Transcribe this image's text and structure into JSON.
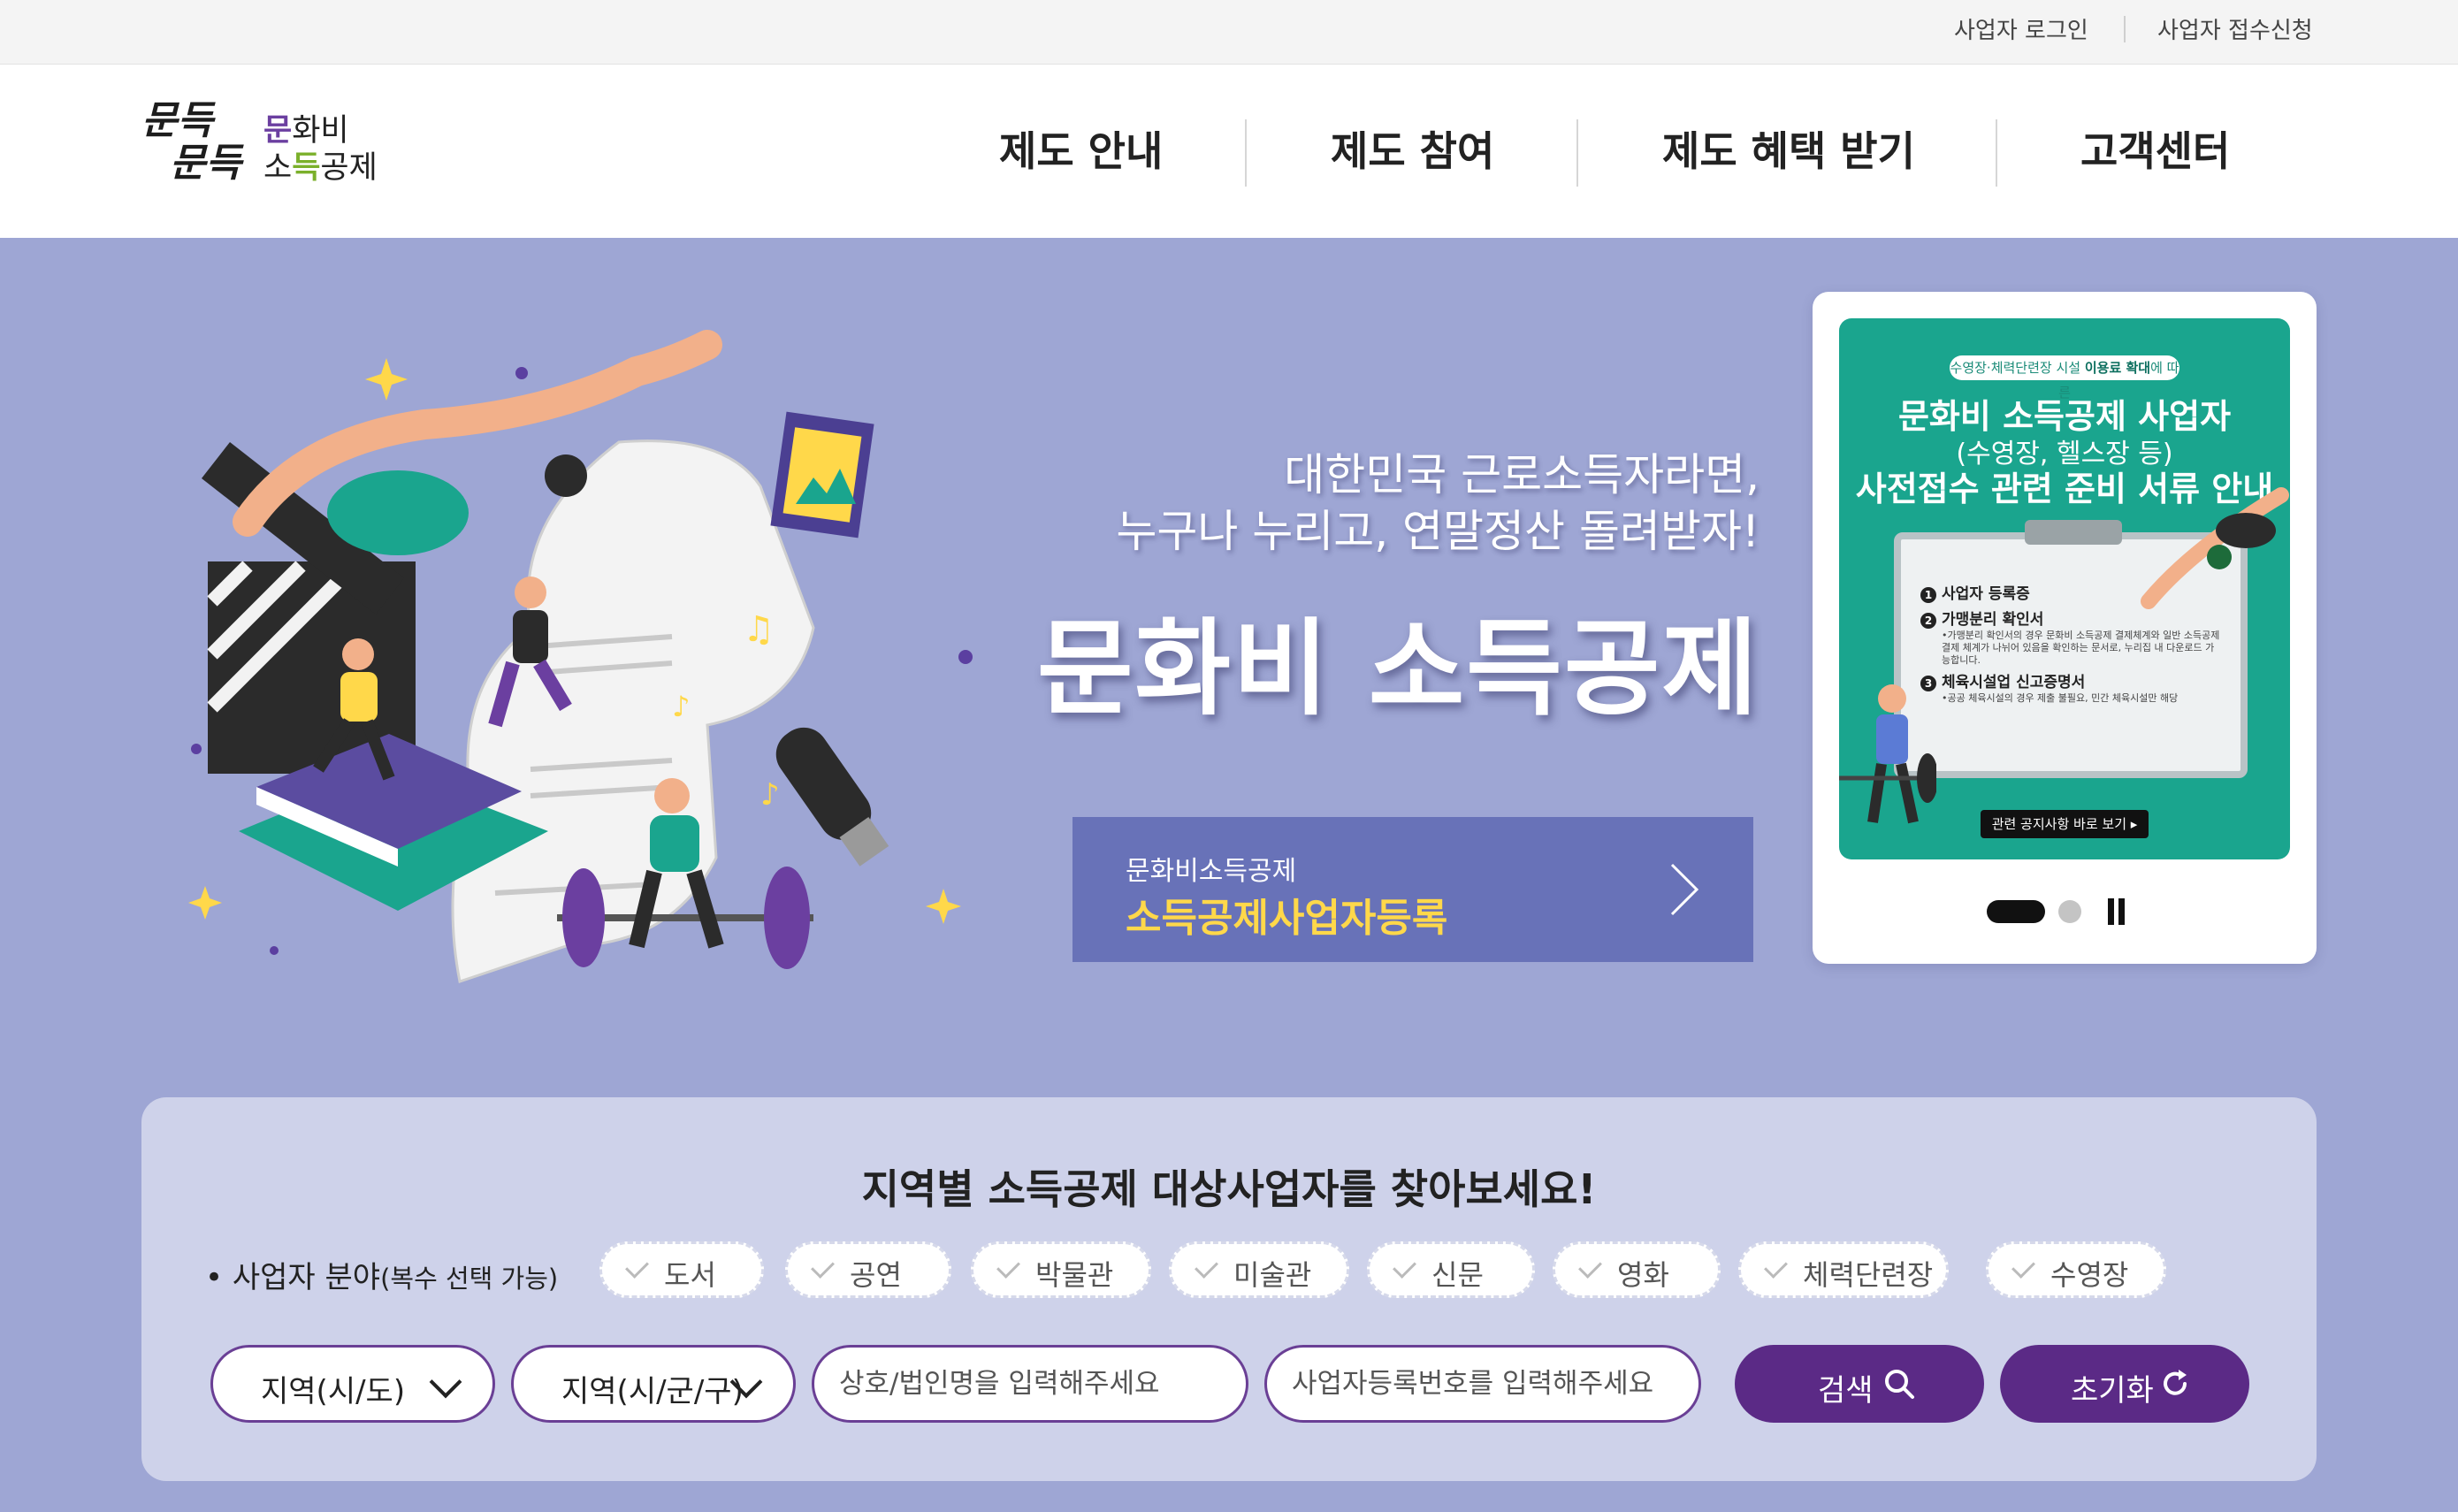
{
  "util": {
    "login": "사업자 로그인",
    "apply": "사업자 접수신청"
  },
  "logo": {
    "script_line1": "문득",
    "script_line2": "문득",
    "text_line1_accent": "문",
    "text_line1_rest": "화비",
    "text_line2_a": "소",
    "text_line2_accent": "득",
    "text_line2_rest": "공제"
  },
  "nav": [
    {
      "label": "제도 안내"
    },
    {
      "label": "제도 참여"
    },
    {
      "label": "제도 혜택 받기"
    },
    {
      "label": "고객센터"
    }
  ],
  "hero": {
    "subtitle_line1": "대한민국 근로소득자라면,",
    "subtitle_line2": "누구나 누리고, 연말정산 돌려받자!",
    "title": "문화비 소득공제",
    "register_small": "문화비소득공제",
    "register_big": "소득공제사업자등록"
  },
  "promo": {
    "pill_prefix": "수영장·체력단련장 시설 ",
    "pill_bold": "이용료 확대",
    "pill_suffix": "에 따른",
    "title1": "문화비 소득공제 사업자",
    "title2": "(수영장, 헬스장 등)",
    "title3": "사전접수 관련 준비 서류 안내",
    "items": [
      {
        "num": "1",
        "label": "사업자 등록증",
        "note": ""
      },
      {
        "num": "2",
        "label": "가맹분리 확인서",
        "note": "•가맹분리 확인서의 경우 문화비 소득공제 결제체계와 일반 소득공제 결제 체계가 나뉘어 있음을 확인하는 문서로, 누리집 내 다운로드 가능합니다."
      },
      {
        "num": "3",
        "label": "체육시설업 신고증명서",
        "note": "•공공 체육시설의 경우 제출 불필요, 민간 체육시설만 해당"
      }
    ],
    "cta": "관련 공지사항 바로 보기 ▸"
  },
  "search": {
    "title": "지역별 소득공제 대상사업자를 찾아보세요!",
    "field_label": "• 사업자 분야",
    "field_label_note": "(복수 선택 가능)",
    "categories": [
      "도서",
      "공연",
      "박물관",
      "미술관",
      "신문",
      "영화",
      "체력단련장",
      "수영장"
    ],
    "region_sido": "지역(시/도)",
    "region_sigungu": "지역(시/군/구)",
    "name_placeholder": "상호/법인명을 입력해주세요",
    "bizno_placeholder": "사업자등록번호를 입력해주세요",
    "search_label": "검색",
    "reset_label": "초기화"
  },
  "colors": {
    "hero_bg": "#9ea6d4",
    "register_bg": "#6872b8",
    "register_highlight": "#ffd84a",
    "accent_purple": "#5b2a86",
    "promo_green": "#1aa58e",
    "panel_bg": "#ced2ea"
  }
}
